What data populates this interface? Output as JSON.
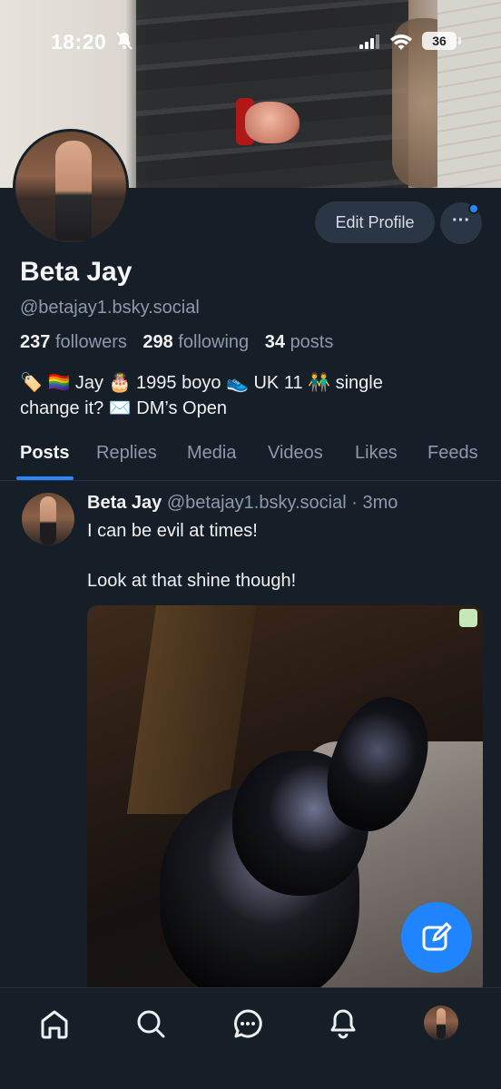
{
  "status_bar": {
    "time": "18:20",
    "battery": "36"
  },
  "profile": {
    "edit_label": "Edit Profile",
    "more_label": "···",
    "name": "Beta Jay",
    "handle": "@betajay1.bsky.social",
    "followers_count": "237",
    "followers_label": "followers",
    "following_count": "298",
    "following_label": "following",
    "posts_count": "34",
    "posts_label": "posts",
    "bio_line1": "🏷️ 🏳️‍🌈 Jay 🎂 1995 boyo 👟 UK 11 👬 single",
    "bio_line2": "change it? ✉️ DM’s Open"
  },
  "tabs": [
    "Posts",
    "Replies",
    "Media",
    "Videos",
    "Likes",
    "Feeds"
  ],
  "active_tab": "Posts",
  "post": {
    "author": "Beta Jay",
    "handle": "@betajay1.bsky.social",
    "separator": "·",
    "time": "3mo",
    "text_line1": "I can be evil at times!",
    "text_line2": "Look at that shine though!"
  },
  "nav": [
    "home-icon",
    "search-icon",
    "chat-icon",
    "notifications-icon",
    "profile-avatar"
  ],
  "colors": {
    "accent": "#1f85ff",
    "background": "#161e27",
    "muted": "#8c9aab"
  }
}
